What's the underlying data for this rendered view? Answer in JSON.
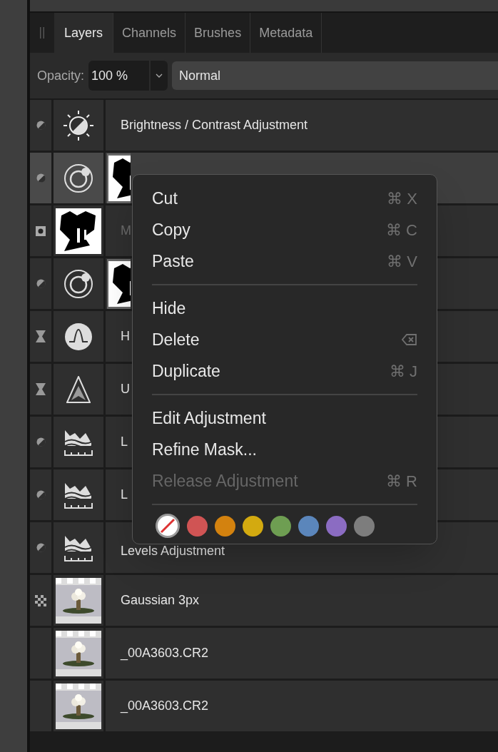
{
  "tabs": [
    {
      "label": "Layers",
      "selected": true
    },
    {
      "label": "Channels",
      "selected": false
    },
    {
      "label": "Brushes",
      "selected": false
    },
    {
      "label": "Metadata",
      "selected": false
    }
  ],
  "toolbar": {
    "opacity_label": "Opacity:",
    "opacity_value": "100 %",
    "blend_mode": "Normal"
  },
  "layers": [
    {
      "mode": {
        "kind": "adjustment"
      },
      "thumb": {
        "kind": "brightness"
      },
      "mask": false,
      "name": "Brightness / Contrast Adjustment",
      "selected": false,
      "dimmed": false
    },
    {
      "mode": {
        "kind": "adjustment"
      },
      "thumb": {
        "kind": "recolor"
      },
      "mask": true,
      "selected": true
    },
    {
      "mode": {
        "kind": "mask"
      },
      "thumb": {
        "kind": "mask"
      },
      "mask": false,
      "name": "M",
      "selected": false,
      "dimmed": true
    },
    {
      "mode": {
        "kind": "adjustment"
      },
      "thumb": {
        "kind": "recolor"
      },
      "mask": true,
      "selected": false
    },
    {
      "mode": {
        "kind": "filter"
      },
      "thumb": {
        "kind": "hsl"
      },
      "mask": false,
      "name": "H",
      "selected": false,
      "dimmed": false
    },
    {
      "mode": {
        "kind": "filter"
      },
      "thumb": {
        "kind": "sharpen"
      },
      "mask": false,
      "name": "U",
      "selected": false,
      "dimmed": false
    },
    {
      "mode": {
        "kind": "adjustment"
      },
      "thumb": {
        "kind": "levels"
      },
      "mask": false,
      "name": "L",
      "selected": false,
      "dimmed": false
    },
    {
      "mode": {
        "kind": "adjustment"
      },
      "thumb": {
        "kind": "levels"
      },
      "mask": false,
      "name": "L",
      "selected": false,
      "dimmed": false
    },
    {
      "mode": {
        "kind": "adjustment"
      },
      "thumb": {
        "kind": "levels"
      },
      "mask": false,
      "name": "Levels Adjustment",
      "selected": false,
      "dimmed": false
    },
    {
      "mode": {
        "kind": "pixel"
      },
      "mask": false,
      "name": "Gaussian 3px",
      "selected": false,
      "dimmed": false
    },
    {
      "mode": {
        "kind": "none"
      },
      "mask": false,
      "name": "_00A3603.CR2",
      "selected": false,
      "dimmed": false
    },
    {
      "mode": {
        "kind": "none"
      },
      "mask": false,
      "name": "_00A3603.CR2",
      "selected": false,
      "dimmed": false
    }
  ],
  "context_menu": {
    "items": [
      {
        "kind": "item",
        "label": "Cut",
        "shortcut": "⌘ X",
        "disabled": false
      },
      {
        "kind": "item",
        "label": "Copy",
        "shortcut": "⌘ C",
        "disabled": false
      },
      {
        "kind": "item",
        "label": "Paste",
        "shortcut": "⌘ V",
        "disabled": false
      },
      {
        "kind": "separator"
      },
      {
        "kind": "item",
        "label": "Hide",
        "disabled": false
      },
      {
        "kind": "item",
        "label": "Delete",
        "shortcut_icon": {
          "kind": "backspace"
        },
        "disabled": false
      },
      {
        "kind": "item",
        "label": "Duplicate",
        "shortcut": "⌘ J",
        "disabled": false
      },
      {
        "kind": "separator"
      },
      {
        "kind": "item",
        "label": "Edit Adjustment",
        "disabled": false
      },
      {
        "kind": "item",
        "label": "Refine Mask...",
        "disabled": false
      },
      {
        "kind": "item",
        "label": "Release Adjustment",
        "shortcut": "⌘ R",
        "disabled": true
      },
      {
        "kind": "separator"
      }
    ],
    "colors": [
      {
        "kind": "none"
      },
      {
        "kind": "color",
        "color": "#d05454"
      },
      {
        "kind": "color",
        "color": "#d3820f"
      },
      {
        "kind": "color",
        "color": "#d3aa10"
      },
      {
        "kind": "color",
        "color": "#6e9e52"
      },
      {
        "kind": "color",
        "color": "#5b86bb"
      },
      {
        "kind": "color",
        "color": "#8b6cc2"
      },
      {
        "kind": "color",
        "color": "#7d7d7d"
      }
    ]
  }
}
